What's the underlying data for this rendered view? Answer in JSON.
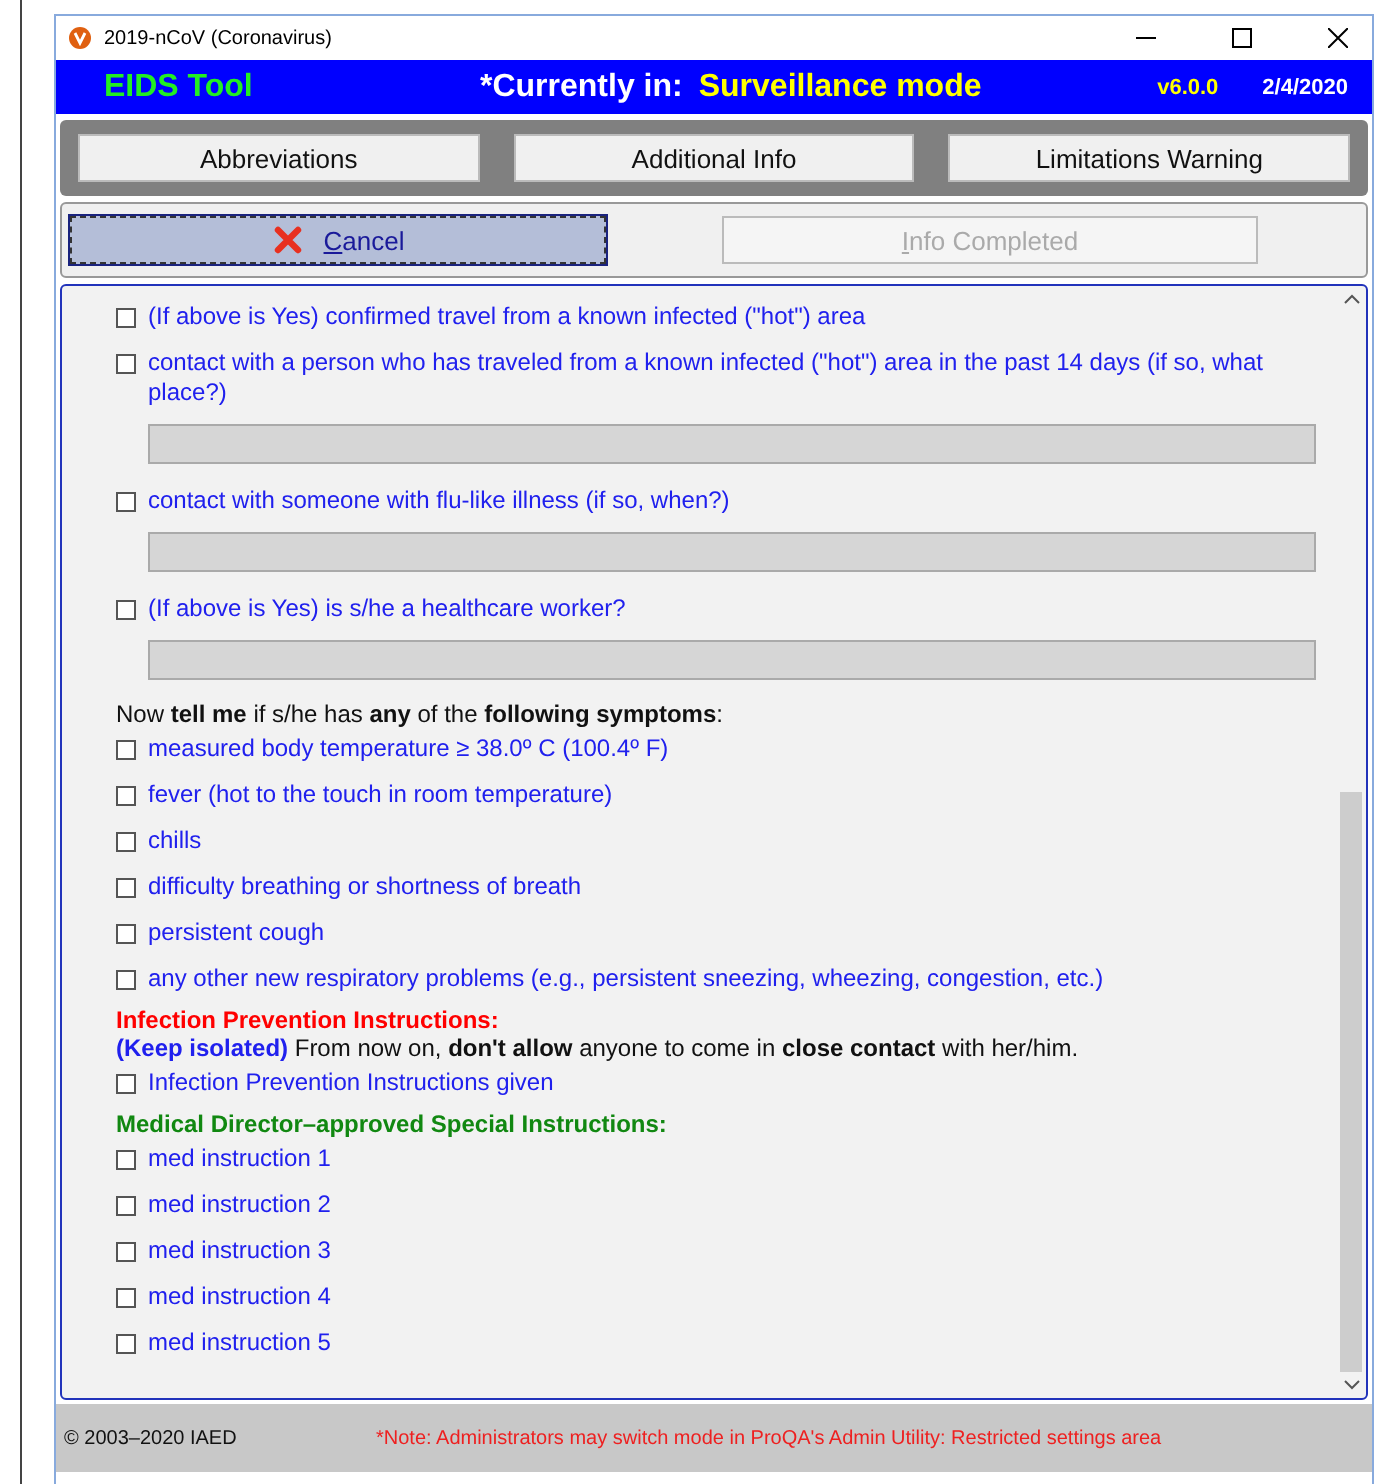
{
  "window": {
    "title": "2019-nCoV (Coronavirus)"
  },
  "header": {
    "app_name": "EIDS Tool",
    "mode_label": "*Currently in:",
    "mode": "Surveillance mode",
    "version": "v6.0.0",
    "date": "2/4/2020"
  },
  "top_buttons": [
    "Abbreviations",
    "Additional Info",
    "Limitations Warning"
  ],
  "actions": [
    {
      "label": "Cancel",
      "disabled": false,
      "focused": true
    },
    {
      "label": "Info Completed",
      "disabled": true,
      "focused": false
    }
  ],
  "items": [
    {
      "kind": "check",
      "label": "(If above is Yes) confirmed travel from a known infected (\"hot\") area",
      "checked": false
    },
    {
      "kind": "check",
      "label": "contact with a person who has traveled from a known infected (\"hot\") area in the past 14 days (if so, what place?)",
      "checked": false
    },
    {
      "kind": "field"
    },
    {
      "kind": "check",
      "label": "contact with someone with flu-like illness (if so, when?)",
      "checked": false
    },
    {
      "kind": "field"
    },
    {
      "kind": "check",
      "label": "(If above is Yes) is s/he a healthcare worker?",
      "checked": false
    },
    {
      "kind": "field"
    },
    {
      "kind": "text",
      "text": "Now **tell me** if s/he has **any** of the **following symptoms**:"
    },
    {
      "kind": "check",
      "label": "measured body temperature ≥ 38.0º C (100.4º F)",
      "checked": false
    },
    {
      "kind": "check",
      "label": "fever (hot to the touch in room temperature)",
      "checked": false
    },
    {
      "kind": "check",
      "label": "chills",
      "checked": false
    },
    {
      "kind": "check",
      "label": "difficulty breathing or shortness of breath",
      "checked": false
    },
    {
      "kind": "check",
      "label": "persistent cough",
      "checked": false
    },
    {
      "kind": "check",
      "label": "any other new respiratory problems (e.g., persistent sneezing, wheezing, congestion, etc.)",
      "checked": false
    },
    {
      "kind": "heading",
      "text": "**Infection Prevention Instructions:**",
      "color": "#ff0000"
    },
    {
      "kind": "note",
      "lead": "(Keep isolated)",
      "text": "From now on, **don't allow** anyone to come in **close contact** with her/him."
    },
    {
      "kind": "check",
      "label": "Infection Prevention Instructions given",
      "checked": false
    },
    {
      "kind": "heading",
      "text": "**Medical Director–approved Special Instructions:**",
      "color": "#118811"
    },
    {
      "kind": "check",
      "label": "med instruction 1",
      "checked": false
    },
    {
      "kind": "check",
      "label": "med instruction 2",
      "checked": false
    },
    {
      "kind": "check",
      "label": "med instruction 3",
      "checked": false
    },
    {
      "kind": "check",
      "label": "med instruction 4",
      "checked": false
    },
    {
      "kind": "check",
      "label": "med instruction 5",
      "checked": false
    }
  ],
  "status_bar": {
    "copyright": "© 2003–2020 IAED",
    "note": "*Note: Administrators may switch mode in ProQA's Admin Utility:  Restricted settings area"
  }
}
